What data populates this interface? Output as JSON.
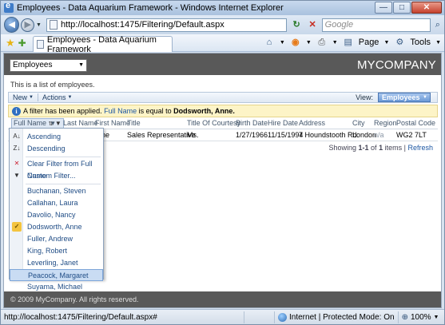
{
  "window": {
    "title": "Employees - Data Aquarium Framework - Windows Internet Explorer",
    "min_glyph": "—",
    "max_glyph": "□",
    "close_glyph": "✕"
  },
  "address": {
    "url": "http://localhost:1475/Filtering/Default.aspx",
    "search_placeholder": "Google"
  },
  "command_bar": {
    "tab_title": "Employees - Data Aquarium Framework",
    "page_label": "Page",
    "tools_label": "Tools"
  },
  "app": {
    "page_select_value": "Employees",
    "brand": "MYCOMPANY",
    "description": "This is a list of employees."
  },
  "toolbar": {
    "new_label": "New",
    "actions_label": "Actions",
    "view_label": "View:",
    "view_value": "Employees"
  },
  "filter": {
    "prefix": "A filter has been applied.",
    "field": "Full Name",
    "middle": "is equal to",
    "value": "Dodsworth, Anne."
  },
  "grid": {
    "columns": {
      "full_name": "Full Name",
      "last_name": "Last Name",
      "first_name": "First Name",
      "title": "Title",
      "title_of_courtesy": "Title Of Courtesy",
      "birth_date": "Birth Date",
      "hire_date": "Hire Date",
      "address": "Address",
      "city": "City",
      "region": "Region",
      "postal_code": "Postal Code"
    },
    "row": {
      "first_name_tail": "ne",
      "title": "Sales Representative",
      "title_of_courtesy": "Ms.",
      "birth_date": "1/27/1966",
      "hire_date": "11/15/1994",
      "address": "7 Houndstooth Rd.",
      "city": "London",
      "region": "n/a",
      "postal_code": "WG2 7LT"
    },
    "pager": {
      "showing": "Showing",
      "range": "1-1",
      "of": "of",
      "total": "1",
      "items": "items",
      "sep": "|",
      "refresh": "Refresh"
    }
  },
  "menu": {
    "sort_items": [
      "Ascending",
      "Descending"
    ],
    "filter_items": [
      "Clear Filter from Full Name",
      "Custom Filter..."
    ],
    "values": [
      "Buchanan, Steven",
      "Callahan, Laura",
      "Davolio, Nancy",
      "Dodsworth, Anne",
      "Fuller, Andrew",
      "King, Robert",
      "Leverling, Janet",
      "Peacock, Margaret",
      "Suyama, Michael"
    ],
    "checked_value": "Dodsworth, Anne",
    "hovered_value": "Peacock, Margaret"
  },
  "footer": {
    "text": "© 2009 MyCompany. All rights reserved."
  },
  "status": {
    "url": "http://localhost:1475/Filtering/Default.aspx#",
    "zone": "Internet | Protected Mode: On",
    "zoom": "100%"
  }
}
